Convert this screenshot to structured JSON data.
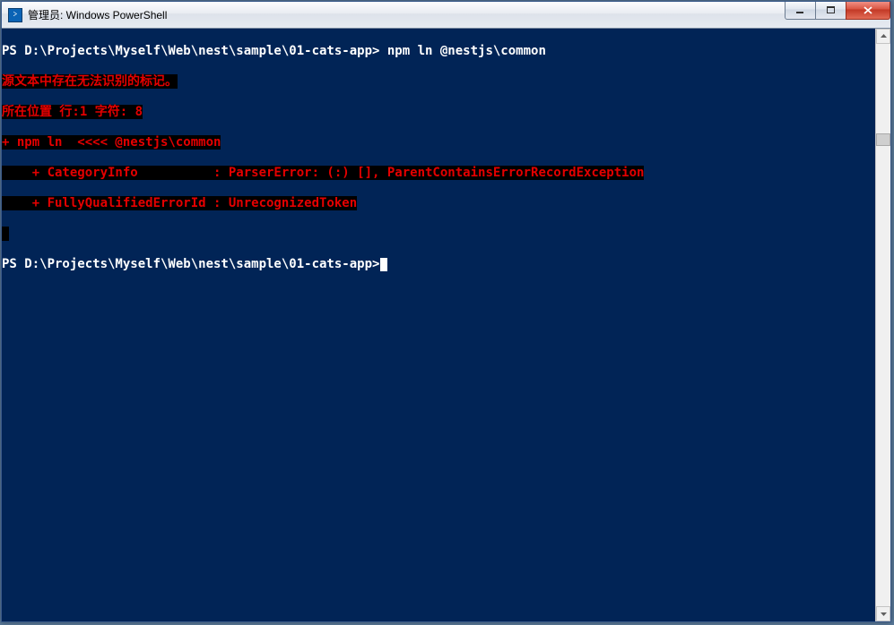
{
  "window": {
    "title": "管理员: Windows PowerShell"
  },
  "terminal": {
    "line1_prompt": "PS D:\\Projects\\Myself\\Web\\nest\\sample\\01-cats-app>",
    "line1_cmd": " npm ln @nestjs\\common",
    "err1": "源文本中存在无法识别的标记。",
    "err2": "所在位置 行:1 字符: 8",
    "err3": "+ npm ln  <<<< @nestjs\\common",
    "err4": "    + CategoryInfo          : ParserError: (:) [], ParentContainsErrorRecordException",
    "err5": "    + FullyQualifiedErrorId : UnrecognizedToken",
    "blank": " ",
    "line2_prompt": "PS D:\\Projects\\Myself\\Web\\nest\\sample\\01-cats-app>"
  }
}
